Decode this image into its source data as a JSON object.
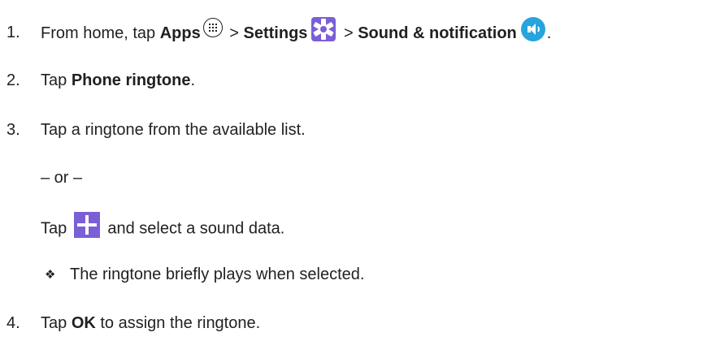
{
  "steps": [
    {
      "number": "1.",
      "text_a": "From home, tap ",
      "apps_label": "Apps",
      "sep_1": " > ",
      "settings_label": "Settings",
      "sep_2": " > ",
      "sound_label": "Sound & notification",
      "end": "."
    },
    {
      "number": "2.",
      "text_a": "Tap ",
      "bold": "Phone ringtone",
      "end": "."
    },
    {
      "number": "3.",
      "text": "Tap a ringtone from the available list.",
      "or_text": "– or –",
      "alt_a": "Tap ",
      "alt_b": " and select a sound data.",
      "note_bullet": "❖",
      "note": "The ringtone briefly plays when selected."
    },
    {
      "number": "4.",
      "text_a": "Tap ",
      "bold": "OK",
      "text_b": " to assign the ringtone."
    }
  ],
  "icons": {
    "apps": "apps-grid-icon",
    "settings": "settings-gear-icon",
    "sound": "speaker-icon",
    "add": "plus-icon"
  },
  "colors": {
    "text": "#231f20",
    "settings_purple": "#7b5fd6",
    "sound_blue": "#27a4dd"
  }
}
